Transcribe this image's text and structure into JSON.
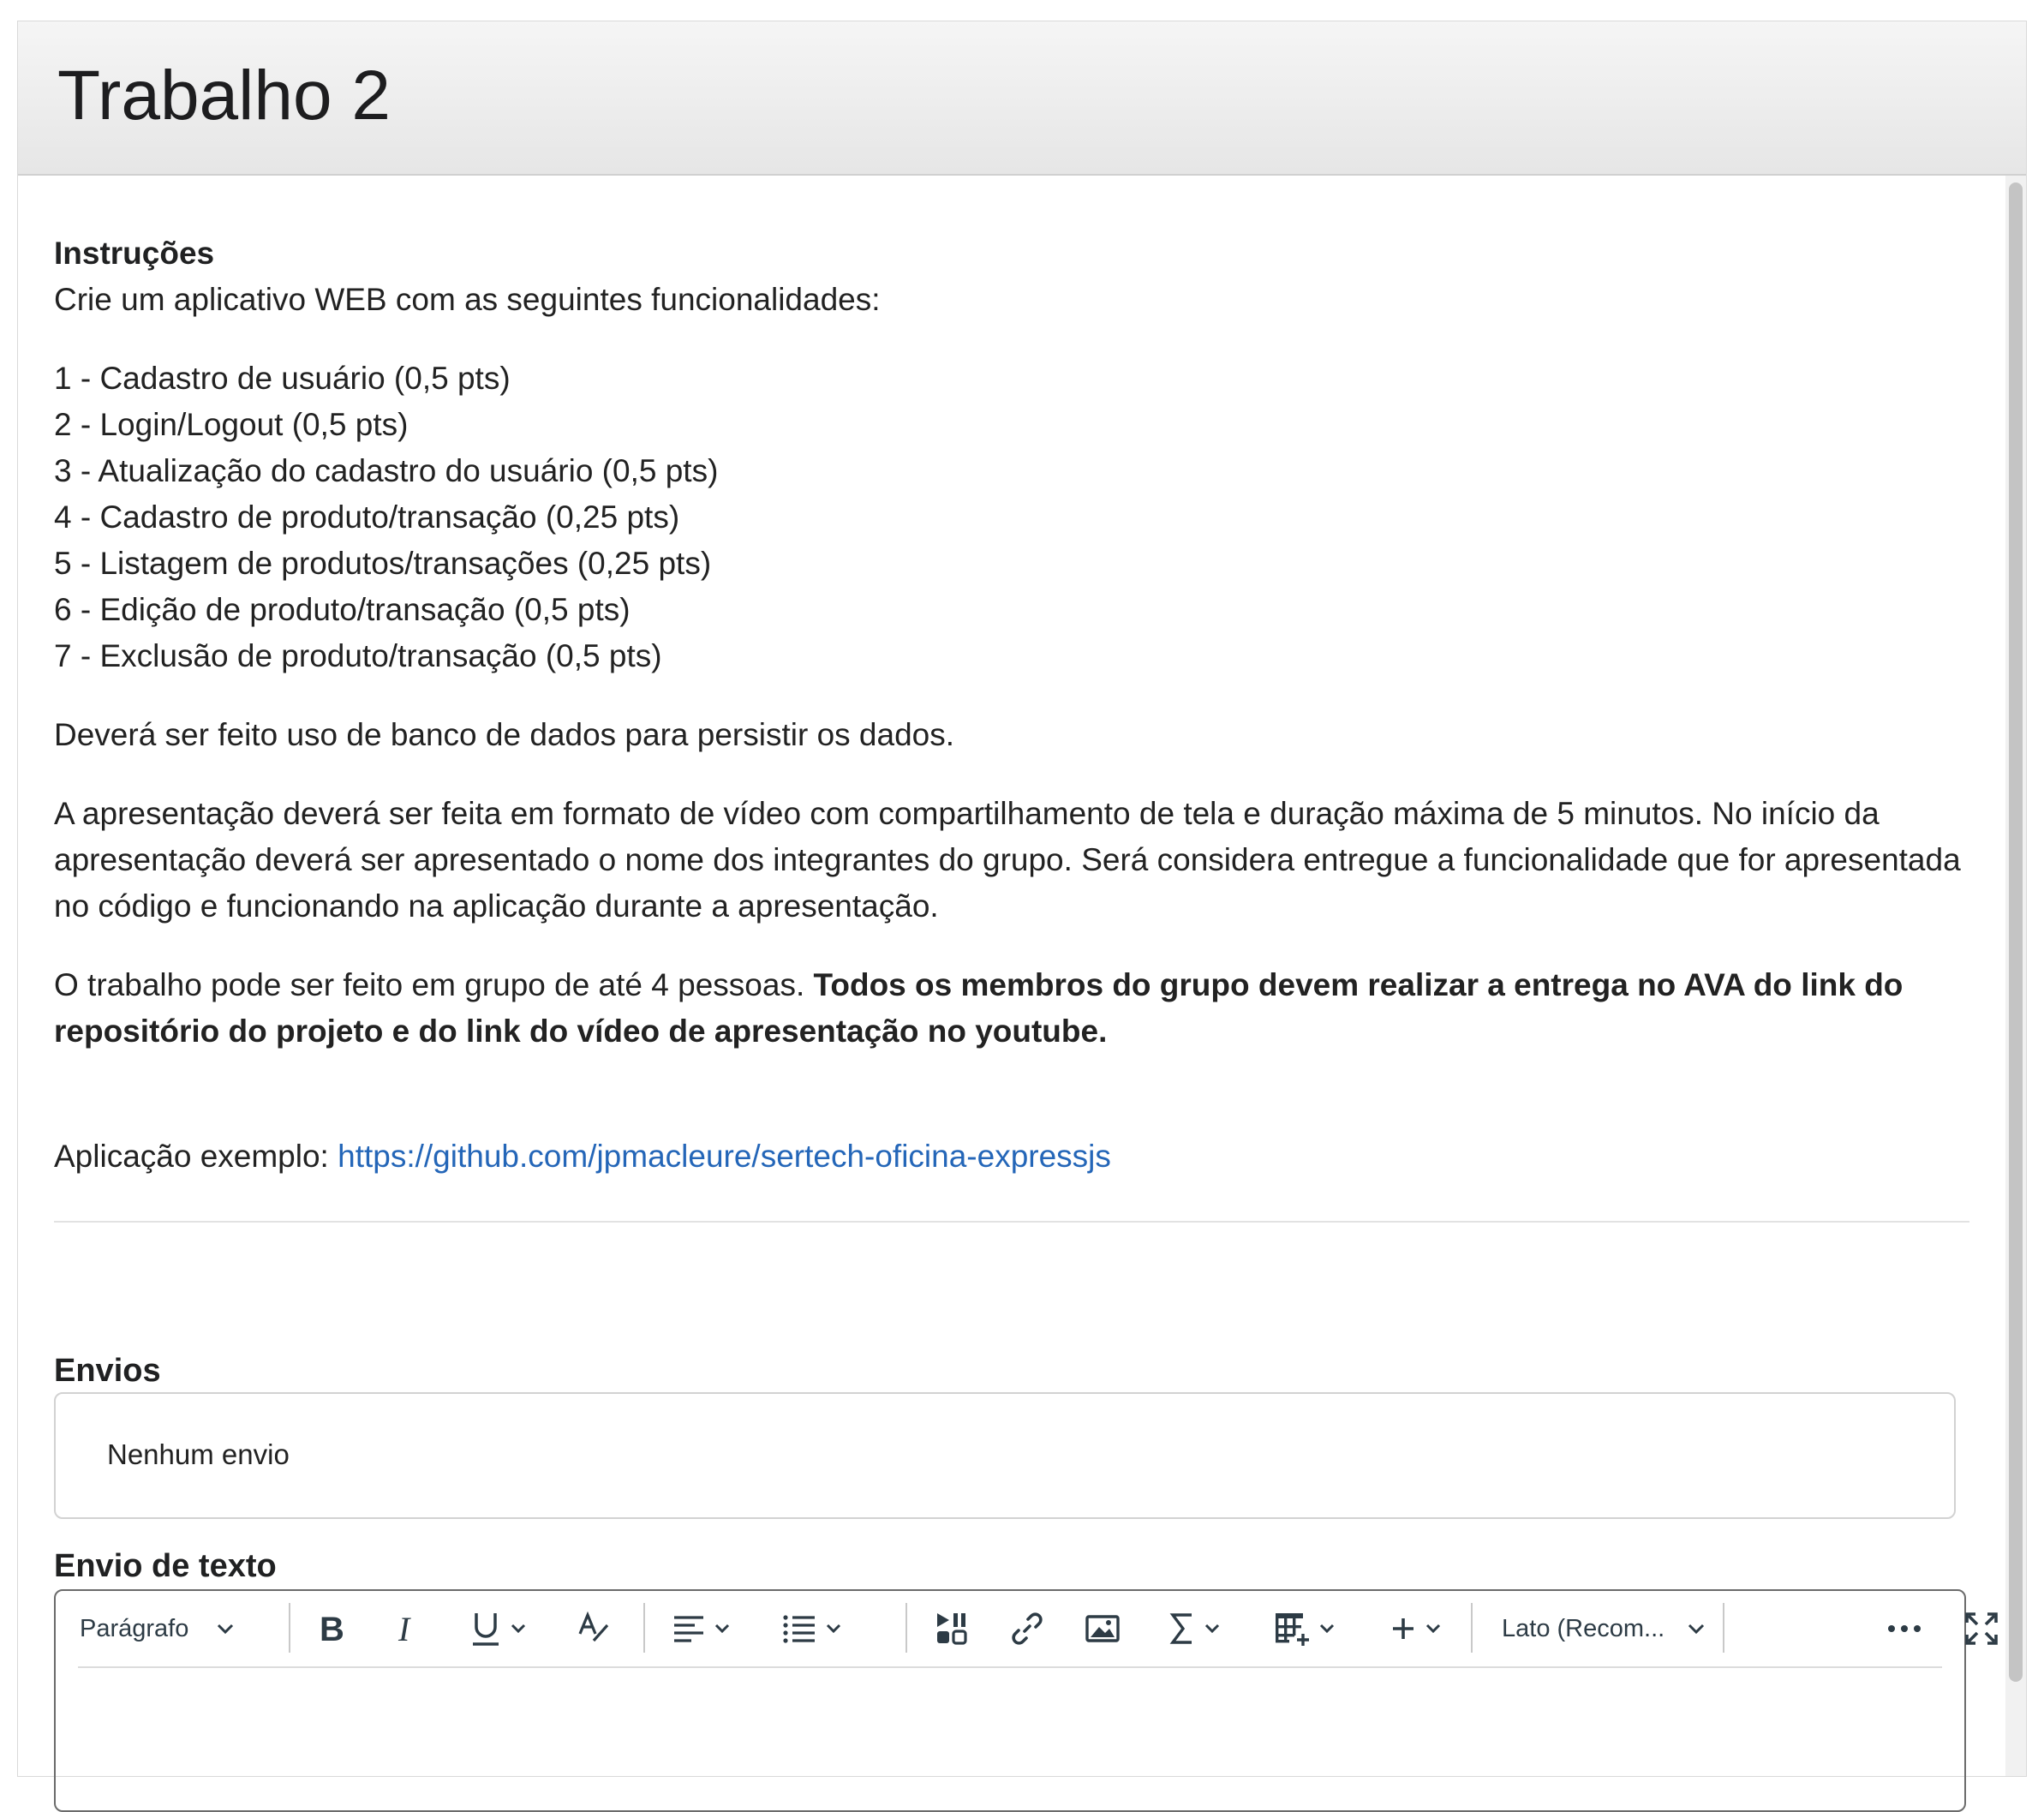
{
  "page": {
    "title": "Trabalho 2"
  },
  "instructions": {
    "heading": "Instruções",
    "intro": "Crie um aplicativo WEB com as seguintes funcionalidades:",
    "items": [
      "1 - Cadastro de usuário (0,5 pts)",
      "2 - Login/Logout (0,5 pts)",
      "3 - Atualização do cadastro do usuário (0,5 pts)",
      "4 - Cadastro de produto/transação (0,25 pts)",
      "5 - Listagem de produtos/transações (0,25 pts)",
      "6 - Edição de produto/transação (0,5 pts)",
      "7 - Exclusão de produto/transação (0,5 pts)"
    ],
    "database_note": "Deverá ser feito uso de banco de dados para persistir os dados.",
    "presentation_note": "A apresentação deverá ser feita em formato de vídeo com compartilhamento de tela e duração máxima de 5 minutos. No início da apresentação deverá ser apresentado o nome dos integrantes do grupo. Será considera entregue a funcionalidade que for apresentada no código e funcionando na aplicação durante a apresentação.",
    "group_note_plain": "O trabalho pode ser feito em grupo de até 4 pessoas. ",
    "group_note_bold": "Todos os membros do grupo devem realizar a entrega no AVA do link do repositório do projeto e do link do vídeo de apresentação no youtube.",
    "example_label": "Aplicação exemplo: ",
    "example_link": "https://github.com/jpmacleure/sertech-oficina-expressjs"
  },
  "submissions": {
    "heading": "Envios",
    "empty_text": "Nenhum envio"
  },
  "text_submission": {
    "heading": "Envio de texto",
    "toolbar": {
      "block_format": "Parágrafo",
      "font_family": "Lato (Recom..."
    }
  },
  "colors": {
    "link": "#2466b8",
    "header_bg": "#ececec",
    "text": "#202122"
  }
}
